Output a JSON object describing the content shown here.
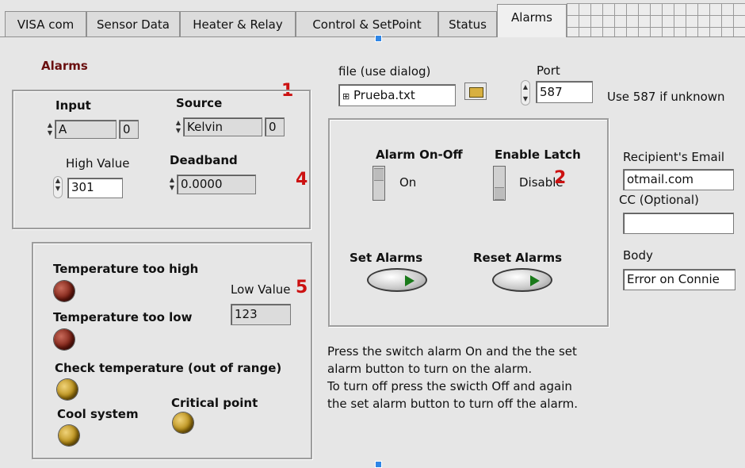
{
  "tabs": [
    {
      "label": "VISA com"
    },
    {
      "label": "Sensor Data"
    },
    {
      "label": "Heater & Relay"
    },
    {
      "label": "Control & SetPoint"
    },
    {
      "label": "Status"
    },
    {
      "label": "Alarms"
    }
  ],
  "active_tab": "Alarms",
  "alarms_title": "Alarms",
  "annotations": {
    "n1": "1",
    "n2": "2",
    "n4": "4",
    "n5": "5"
  },
  "input": {
    "label": "Input",
    "value": "A",
    "index": "0"
  },
  "source": {
    "label": "Source",
    "value": "Kelvin",
    "index": "0"
  },
  "high_value": {
    "label": "High Value",
    "value": "301"
  },
  "deadband": {
    "label": "Deadband",
    "value": "0.0000"
  },
  "indicators": {
    "too_high": "Temperature too high",
    "too_low": "Temperature too low",
    "check": "Check temperature (out of range)",
    "cool": "Cool system",
    "critical": "Critical point"
  },
  "low_value": {
    "label": "Low Value",
    "value": "123"
  },
  "file": {
    "label": "file (use dialog)",
    "value": "Prueba.txt"
  },
  "port": {
    "label": "Port",
    "value": "587",
    "hint": "Use 587 if unknown"
  },
  "alarm_switch": {
    "label": "Alarm On-Off",
    "state": "On"
  },
  "latch_switch": {
    "label": "Enable Latch",
    "state": "Disable"
  },
  "buttons": {
    "set": "Set Alarms",
    "reset": "Reset Alarms"
  },
  "email": {
    "recipient_label": "Recipient's Email",
    "recipient_value": "otmail.com",
    "cc_label": "CC (Optional)",
    "cc_value": "",
    "body_label": "Body",
    "body_value": "Error on Connie"
  },
  "instructions": [
    "Press the switch alarm On and the the set",
    "alarm button to turn on the alarm.",
    "To turn off press the swicth Off and again",
    "the set alarm button to turn off the alarm."
  ],
  "colors": {
    "annotation": "#cc1111",
    "led_red": "#7a1e12",
    "led_yellow": "#b58a12",
    "accent_handle": "#2f86e6"
  }
}
